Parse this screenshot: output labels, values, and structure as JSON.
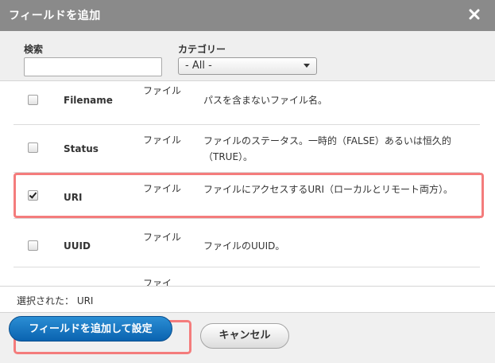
{
  "dialog": {
    "title": "フィールドを追加",
    "close_icon": "close-icon"
  },
  "filters": {
    "search_label": "検索",
    "search_value": "",
    "category_label": "カテゴリー",
    "category_value": "- All -"
  },
  "rows": [
    {
      "name": "Filename",
      "category": "ファイル",
      "description": "パスを含まないファイル名。",
      "checked": false
    },
    {
      "name": "Status",
      "category": "ファイル",
      "description": "ファイルのステータス。一時的（FALSE）あるいは恒久的（TRUE）。",
      "checked": false
    },
    {
      "name": "URI",
      "category": "ファイル",
      "description": "ファイルにアクセスするURI（ローカルとリモート両方）。",
      "checked": true
    },
    {
      "name": "UUID",
      "category": "ファイル",
      "description": "ファイルのUUID。",
      "checked": false
    },
    {
      "name": "",
      "category": "ファイ",
      "description": "",
      "checked": false
    }
  ],
  "selection": {
    "text": "選択された： URI"
  },
  "footer": {
    "primary_label": "フィールドを追加して設定",
    "cancel_label": "キャンセル"
  },
  "colors": {
    "titlebar": "#8a8a8a",
    "primary": "#0a63b0",
    "highlight": "#f47c7c"
  }
}
